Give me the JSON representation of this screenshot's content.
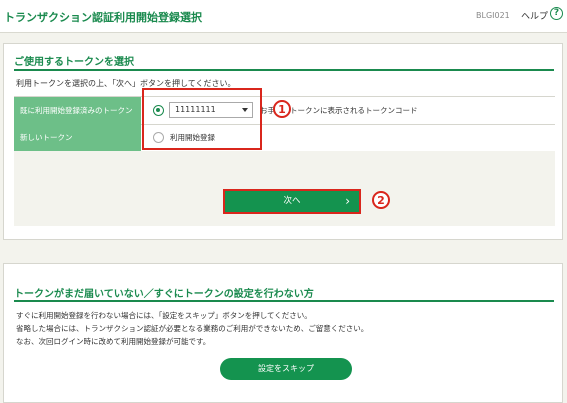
{
  "header": {
    "title": "トランザクション認証利用開始登録選択",
    "screen_id": "BLGI021",
    "help_label": "ヘルプ",
    "help_icon": "?"
  },
  "token_section": {
    "title": "ご使用するトークンを選択",
    "instruction": "利用トークンを選択の上、「次へ」ボタンを押してください。",
    "rows": [
      {
        "label": "既に利用開始登録済みのトークン",
        "selected": true,
        "select_value": "11111111",
        "hint": "お手元のトークンに表示されるトークンコード"
      },
      {
        "label": "新しいトークン",
        "selected": false,
        "option_text": "利用開始登録"
      }
    ],
    "next_button": "次へ",
    "next_chevron": "›"
  },
  "callouts": [
    "1",
    "2"
  ],
  "skip_section": {
    "title": "トークンがまだ届いていない／すぐにトークンの設定を行わない方",
    "lines": [
      "すぐに利用開始登録を行わない場合には、「設定をスキップ」ボタンを押してください。",
      "省略した場合には、トランザクション認証が必要となる業務のご利用ができないため、ご留意ください。",
      "なお、次回ログイン時に改めて利用開始登録が可能です。"
    ],
    "skip_button": "設定をスキップ"
  },
  "colors": {
    "accent": "#1a8a4e",
    "label_bg": "#6dbf88",
    "callout": "#d9261c"
  }
}
